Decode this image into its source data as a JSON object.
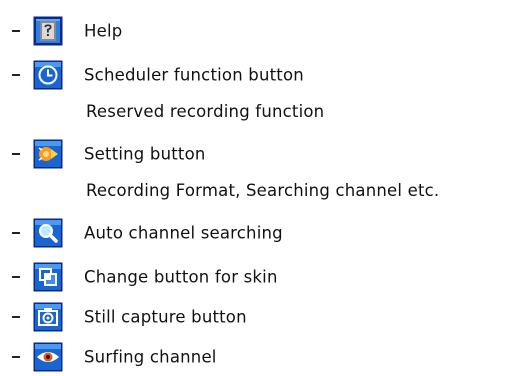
{
  "items": [
    {
      "icon": "help-icon",
      "label": "Help"
    },
    {
      "icon": "clock-icon",
      "label": "Scheduler function button",
      "sub": "Reserved recording function"
    },
    {
      "icon": "setting-icon",
      "label": "Setting button",
      "sub": "Recording Format, Searching channel etc."
    },
    {
      "icon": "magnifier-icon",
      "label": "Auto channel searching"
    },
    {
      "icon": "skin-change-icon",
      "label": "Change button for skin"
    },
    {
      "icon": "camera-icon",
      "label": "Still capture button"
    },
    {
      "icon": "eye-icon",
      "label": "Surfing channel"
    }
  ],
  "colors": {
    "icon_frame": "#0a2a8a",
    "icon_fill": "#1e6fd9",
    "icon_light": "#7fc8ff"
  }
}
